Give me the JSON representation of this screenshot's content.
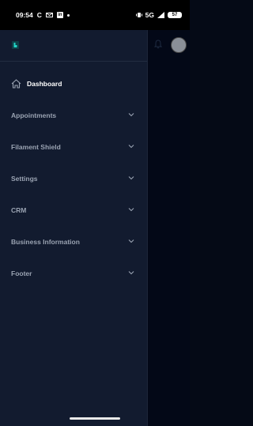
{
  "status_bar": {
    "time": "09:54",
    "carrier_icons": [
      "c-icon",
      "mail-icon",
      "linkedin-icon",
      "dot"
    ],
    "network": "5G",
    "battery": "57"
  },
  "sidebar": {
    "items": [
      {
        "label": "Dashboard",
        "active": true
      },
      {
        "label": "Appointments"
      },
      {
        "label": "Filament Shield"
      },
      {
        "label": "Settings"
      },
      {
        "label": "CRM"
      },
      {
        "label": "Business Information"
      },
      {
        "label": "Footer"
      }
    ]
  },
  "colors": {
    "drawer_bg": "#121b2f",
    "backdrop": "#030817",
    "accent": "#22d3c5",
    "text_muted": "#9aa3b2"
  }
}
